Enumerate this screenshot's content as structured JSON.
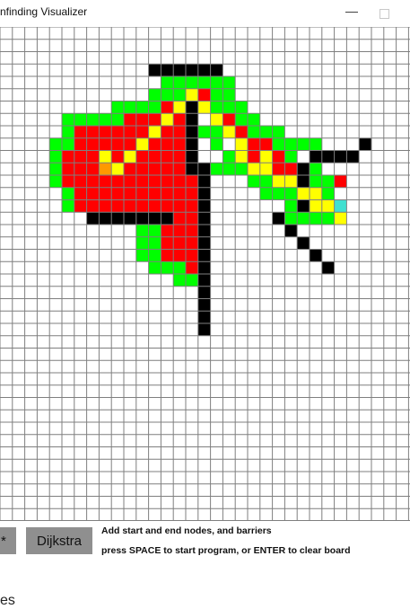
{
  "window": {
    "title": "nfinding Visualizer",
    "minimize_symbol": "—",
    "maximize_icon": "square-icon"
  },
  "grid": {
    "rows": 40,
    "cols": 33,
    "colors": {
      "empty": "#ffffff",
      "line": "#7f7f7f",
      "barrier": "#000000",
      "open": "#00ff00",
      "closed": "#ff0000",
      "path": "#ffff00",
      "start": "#ff9900",
      "end": "#40e0d0"
    },
    "cells": {
      "barrier": [
        [
          3,
          12
        ],
        [
          3,
          13
        ],
        [
          3,
          14
        ],
        [
          3,
          15
        ],
        [
          3,
          16
        ],
        [
          3,
          17
        ],
        [
          6,
          15
        ],
        [
          7,
          15
        ],
        [
          8,
          15
        ],
        [
          9,
          15
        ],
        [
          10,
          15
        ],
        [
          10,
          25
        ],
        [
          10,
          26
        ],
        [
          10,
          27
        ],
        [
          10,
          28
        ],
        [
          11,
          15
        ],
        [
          11,
          16
        ],
        [
          11,
          24
        ],
        [
          12,
          16
        ],
        [
          12,
          24
        ],
        [
          13,
          16
        ],
        [
          14,
          16
        ],
        [
          14,
          24
        ],
        [
          15,
          7
        ],
        [
          15,
          8
        ],
        [
          15,
          9
        ],
        [
          15,
          10
        ],
        [
          15,
          11
        ],
        [
          15,
          12
        ],
        [
          15,
          13
        ],
        [
          15,
          16
        ],
        [
          15,
          22
        ],
        [
          16,
          16
        ],
        [
          16,
          23
        ],
        [
          17,
          16
        ],
        [
          17,
          24
        ],
        [
          18,
          16
        ],
        [
          18,
          25
        ],
        [
          19,
          16
        ],
        [
          19,
          26
        ],
        [
          20,
          16
        ],
        [
          21,
          16
        ],
        [
          22,
          16
        ],
        [
          23,
          16
        ],
        [
          24,
          16
        ],
        [
          24,
          16
        ],
        [
          9,
          29
        ]
      ],
      "open": [
        [
          4,
          13
        ],
        [
          4,
          14
        ],
        [
          4,
          15
        ],
        [
          4,
          16
        ],
        [
          4,
          17
        ],
        [
          4,
          18
        ],
        [
          5,
          12
        ],
        [
          5,
          13
        ],
        [
          5,
          14
        ],
        [
          5,
          17
        ],
        [
          5,
          18
        ],
        [
          6,
          9
        ],
        [
          6,
          10
        ],
        [
          6,
          11
        ],
        [
          6,
          12
        ],
        [
          6,
          17
        ],
        [
          6,
          18
        ],
        [
          6,
          19
        ],
        [
          7,
          5
        ],
        [
          7,
          6
        ],
        [
          7,
          7
        ],
        [
          7,
          8
        ],
        [
          7,
          9
        ],
        [
          7,
          19
        ],
        [
          7,
          20
        ],
        [
          8,
          5
        ],
        [
          8,
          16
        ],
        [
          8,
          17
        ],
        [
          8,
          20
        ],
        [
          8,
          21
        ],
        [
          8,
          22
        ],
        [
          9,
          4
        ],
        [
          9,
          5
        ],
        [
          9,
          17
        ],
        [
          9,
          22
        ],
        [
          9,
          23
        ],
        [
          9,
          24
        ],
        [
          9,
          25
        ],
        [
          10,
          4
        ],
        [
          10,
          18
        ],
        [
          10,
          23
        ],
        [
          11,
          4
        ],
        [
          11,
          17
        ],
        [
          11,
          18
        ],
        [
          11,
          19
        ],
        [
          11,
          20
        ],
        [
          11,
          21
        ],
        [
          12,
          4
        ],
        [
          12,
          20
        ],
        [
          12,
          21
        ],
        [
          12,
          22
        ],
        [
          12,
          25
        ],
        [
          13,
          5
        ],
        [
          13,
          21
        ],
        [
          13,
          22
        ],
        [
          13,
          23
        ],
        [
          13,
          26
        ],
        [
          14,
          5
        ],
        [
          14,
          23
        ],
        [
          14,
          27
        ],
        [
          15,
          23
        ],
        [
          15,
          24
        ],
        [
          15,
          25
        ],
        [
          15,
          26
        ],
        [
          15,
          27
        ],
        [
          16,
          11
        ],
        [
          16,
          12
        ],
        [
          17,
          11
        ],
        [
          17,
          12
        ],
        [
          18,
          11
        ],
        [
          18,
          12
        ],
        [
          19,
          12
        ],
        [
          19,
          13
        ],
        [
          19,
          14
        ],
        [
          20,
          14
        ],
        [
          20,
          15
        ],
        [
          12,
          26
        ],
        [
          11,
          25
        ],
        [
          12,
          23
        ],
        [
          14,
          25
        ]
      ],
      "closed": [
        [
          5,
          15
        ],
        [
          5,
          16
        ],
        [
          6,
          13
        ],
        [
          6,
          14
        ],
        [
          7,
          10
        ],
        [
          7,
          11
        ],
        [
          7,
          12
        ],
        [
          7,
          13
        ],
        [
          7,
          14
        ],
        [
          8,
          6
        ],
        [
          8,
          7
        ],
        [
          8,
          8
        ],
        [
          8,
          9
        ],
        [
          8,
          10
        ],
        [
          8,
          11
        ],
        [
          8,
          12
        ],
        [
          8,
          13
        ],
        [
          8,
          14
        ],
        [
          9,
          6
        ],
        [
          9,
          7
        ],
        [
          9,
          8
        ],
        [
          9,
          9
        ],
        [
          9,
          10
        ],
        [
          9,
          12
        ],
        [
          9,
          13
        ],
        [
          9,
          14
        ],
        [
          10,
          5
        ],
        [
          10,
          6
        ],
        [
          10,
          7
        ],
        [
          10,
          9
        ],
        [
          10,
          10
        ],
        [
          10,
          11
        ],
        [
          10,
          12
        ],
        [
          10,
          13
        ],
        [
          10,
          14
        ],
        [
          11,
          5
        ],
        [
          11,
          6
        ],
        [
          11,
          7
        ],
        [
          11,
          8
        ],
        [
          11,
          9
        ],
        [
          11,
          10
        ],
        [
          11,
          11
        ],
        [
          11,
          12
        ],
        [
          11,
          13
        ],
        [
          11,
          14
        ],
        [
          12,
          5
        ],
        [
          12,
          6
        ],
        [
          12,
          7
        ],
        [
          12,
          8
        ],
        [
          12,
          9
        ],
        [
          12,
          10
        ],
        [
          12,
          11
        ],
        [
          12,
          12
        ],
        [
          12,
          13
        ],
        [
          12,
          14
        ],
        [
          12,
          15
        ],
        [
          13,
          6
        ],
        [
          13,
          7
        ],
        [
          13,
          8
        ],
        [
          13,
          9
        ],
        [
          13,
          10
        ],
        [
          13,
          11
        ],
        [
          13,
          12
        ],
        [
          13,
          13
        ],
        [
          13,
          14
        ],
        [
          13,
          15
        ],
        [
          14,
          6
        ],
        [
          14,
          7
        ],
        [
          14,
          8
        ],
        [
          14,
          9
        ],
        [
          14,
          10
        ],
        [
          14,
          11
        ],
        [
          14,
          12
        ],
        [
          14,
          13
        ],
        [
          14,
          14
        ],
        [
          14,
          15
        ],
        [
          15,
          14
        ],
        [
          15,
          15
        ],
        [
          16,
          13
        ],
        [
          16,
          14
        ],
        [
          16,
          15
        ],
        [
          17,
          13
        ],
        [
          17,
          14
        ],
        [
          17,
          15
        ],
        [
          18,
          13
        ],
        [
          18,
          14
        ],
        [
          18,
          15
        ],
        [
          19,
          15
        ],
        [
          6,
          16
        ],
        [
          7,
          17
        ],
        [
          7,
          18
        ],
        [
          8,
          19
        ],
        [
          9,
          20
        ],
        [
          9,
          21
        ],
        [
          10,
          21
        ],
        [
          10,
          22
        ],
        [
          11,
          23
        ],
        [
          12,
          27
        ],
        [
          14,
          26
        ],
        [
          13,
          24
        ],
        [
          13,
          25
        ],
        [
          10,
          20
        ],
        [
          11,
          22
        ]
      ],
      "path": [
        [
          5,
          15
        ],
        [
          6,
          14
        ],
        [
          6,
          16
        ],
        [
          7,
          13
        ],
        [
          7,
          17
        ],
        [
          8,
          12
        ],
        [
          8,
          18
        ],
        [
          9,
          11
        ],
        [
          9,
          19
        ],
        [
          10,
          10
        ],
        [
          10,
          19
        ],
        [
          11,
          9
        ],
        [
          10,
          8
        ],
        [
          11,
          20
        ],
        [
          12,
          22
        ],
        [
          12,
          23
        ],
        [
          13,
          24
        ],
        [
          13,
          25
        ],
        [
          14,
          25
        ],
        [
          14,
          26
        ],
        [
          15,
          27
        ],
        [
          11,
          21
        ],
        [
          10,
          21
        ]
      ],
      "start": [
        [
          11,
          8
        ]
      ],
      "end": [
        [
          14,
          27
        ]
      ]
    }
  },
  "buttons": {
    "astar": "*",
    "dijkstra": "Dijkstra"
  },
  "instructions": {
    "line1": "Add start and end nodes, and barriers",
    "line2": "press SPACE to start program, or ENTER to clear board"
  },
  "partial_text": "es"
}
